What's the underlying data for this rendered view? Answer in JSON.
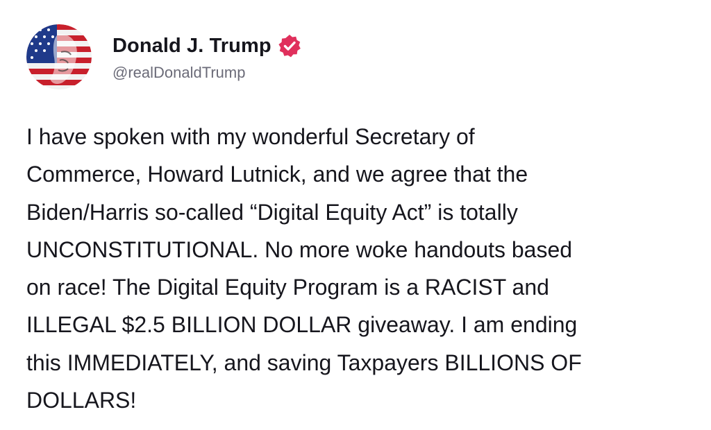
{
  "author": {
    "display_name": "Donald J. Trump",
    "handle": "@realDonaldTrump",
    "verified": true,
    "verified_badge_color": "#e0305c",
    "avatar_description_icon": "user-avatar-icon"
  },
  "post": {
    "lines": [
      "I have spoken with my wonderful Secretary of",
      "Commerce, Howard Lutnick, and we agree that the",
      "Biden/Harris so-called “Digital Equity Act” is totally",
      "UNCONSTITUTIONAL. No more woke handouts based",
      "on race! The Digital Equity Program is a RACIST and",
      "ILLEGAL $2.5 BILLION DOLLAR giveaway. I am ending",
      "this IMMEDIATELY, and saving Taxpayers BILLIONS OF",
      "DOLLARS!"
    ]
  },
  "colors": {
    "text": "#16161d",
    "muted": "#6b6b78",
    "background": "#ffffff"
  }
}
